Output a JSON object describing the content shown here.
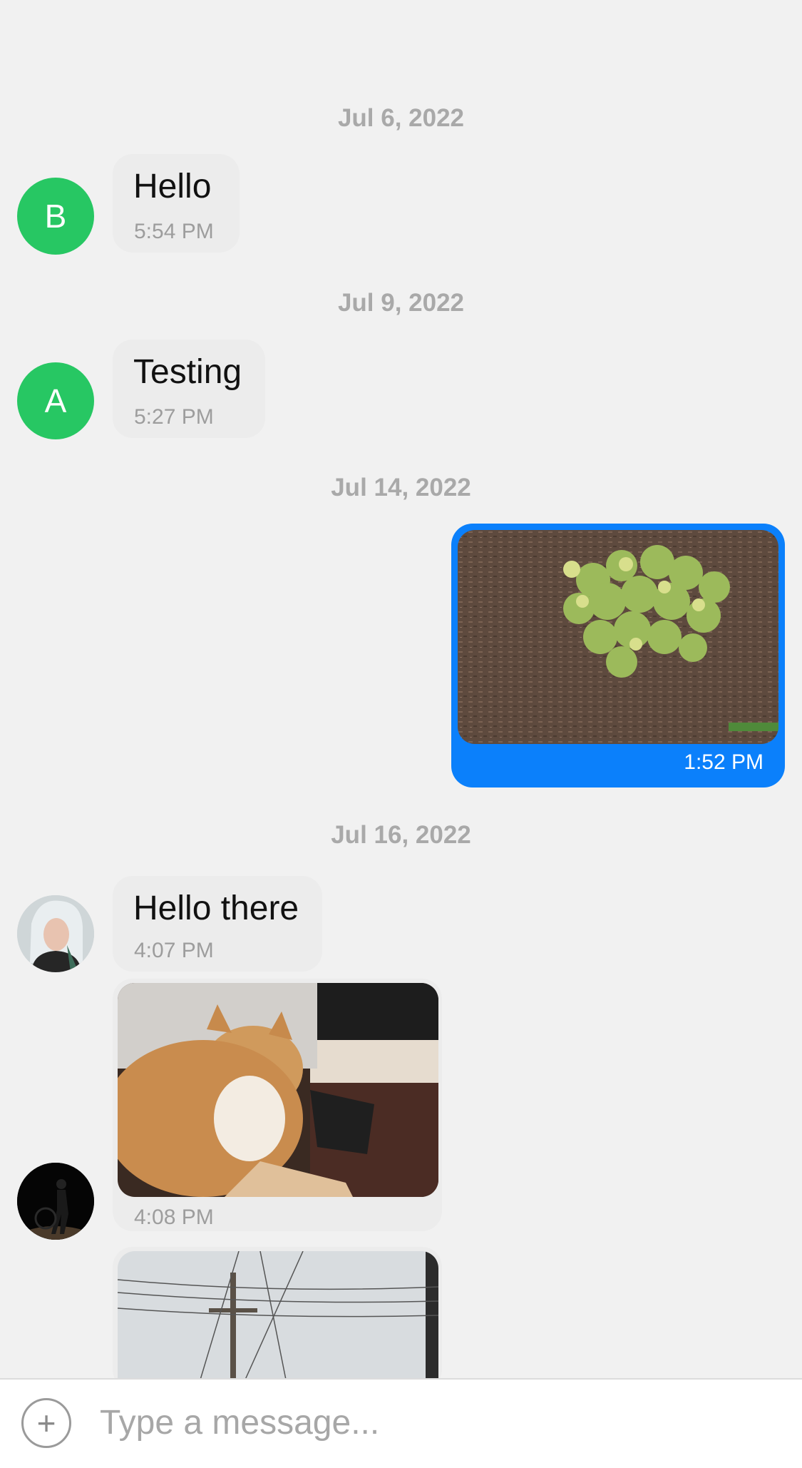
{
  "conversation": {
    "date_1": "Jul 6, 2022",
    "msg_1": {
      "avatar": "B",
      "text": "Hello",
      "time": "5:54 PM"
    },
    "date_2": "Jul 9, 2022",
    "msg_2": {
      "avatar": "A",
      "text": "Testing",
      "time": "5:27 PM"
    },
    "date_3": "Jul 14, 2022",
    "msg_3": {
      "attachment": "plant-photo",
      "time": "1:52 PM"
    },
    "date_4": "Jul 16, 2022",
    "msg_4": {
      "avatar": "woman-portrait-avatar",
      "text": "Hello there",
      "time": "4:07 PM"
    },
    "msg_5": {
      "avatar": "dark-silhouette-avatar",
      "attachment": "cat-photo",
      "time": "4:08 PM"
    },
    "msg_6": {
      "attachment": "power-lines-photo"
    }
  },
  "composer": {
    "placeholder": "Type a message..."
  },
  "colors": {
    "background": "#f1f1f1",
    "sent_bubble": "#0b80fb",
    "received_bubble": "#ececec",
    "letter_avatar": "#27c763"
  }
}
